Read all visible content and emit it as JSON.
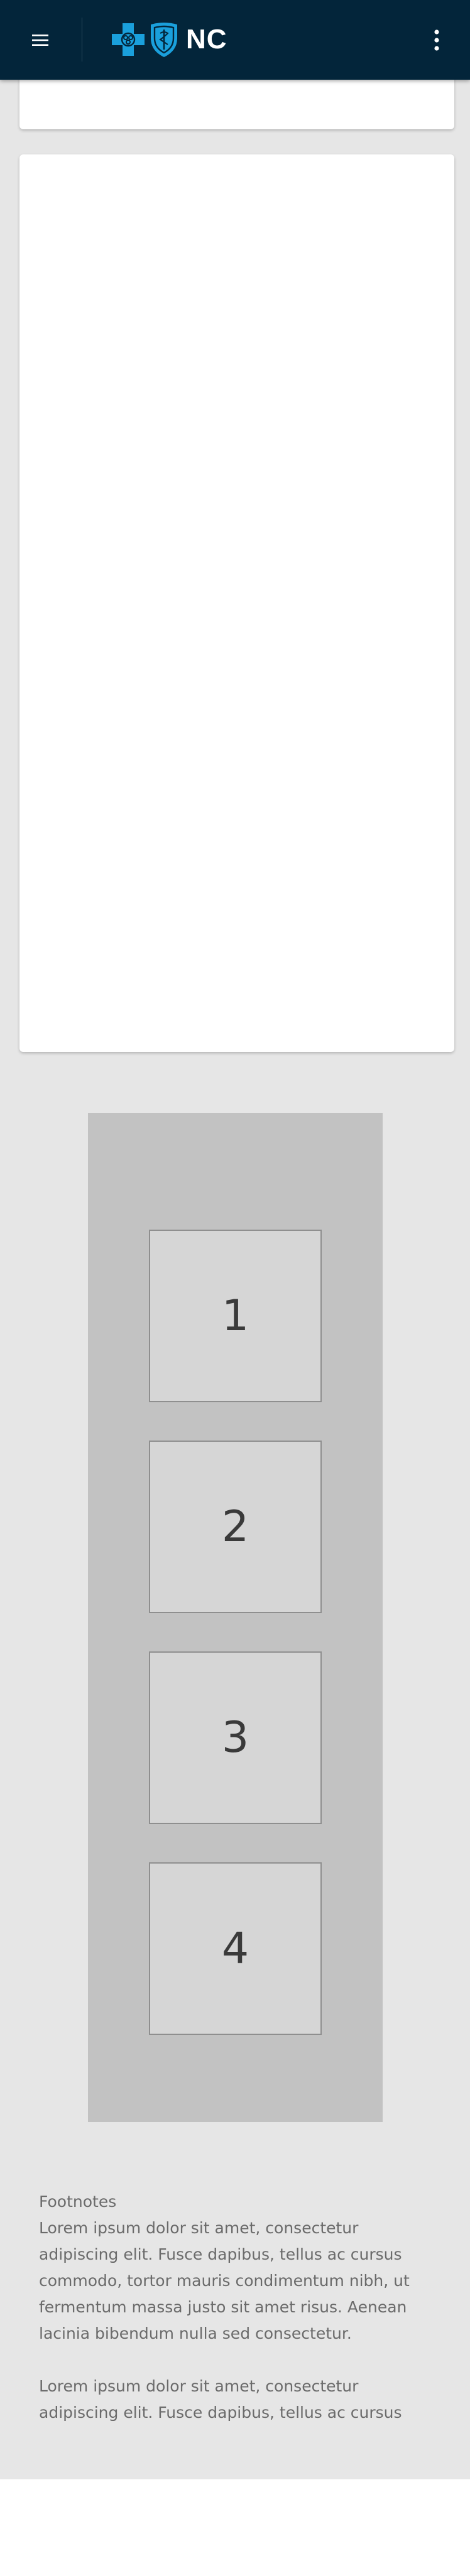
{
  "header": {
    "logo_text": "NC",
    "logo_alt": "Blue Cross Blue Shield NC",
    "icons": {
      "menu": "hamburger-menu-icon",
      "more": "vertical-ellipsis-icon",
      "cross": "blue-cross-icon",
      "shield": "blue-shield-icon"
    },
    "colors": {
      "background": "#03253a",
      "brand_blue": "#1aa0dc"
    }
  },
  "tiles": [
    {
      "label": "1"
    },
    {
      "label": "2"
    },
    {
      "label": "3"
    },
    {
      "label": "4"
    }
  ],
  "footnotes": {
    "title": "Footnotes",
    "paragraph1": "Lorem ipsum dolor sit amet, consectetur adipiscing elit. Fusce dapibus, tellus ac cursus commodo, tortor mauris condimentum nibh, ut fermentum massa justo sit amet risus. Aenean lacinia bibendum nulla sed consectetur.",
    "paragraph2": "Lorem ipsum dolor sit amet, consectetur adipiscing elit. Fusce dapibus, tellus ac cursus"
  }
}
